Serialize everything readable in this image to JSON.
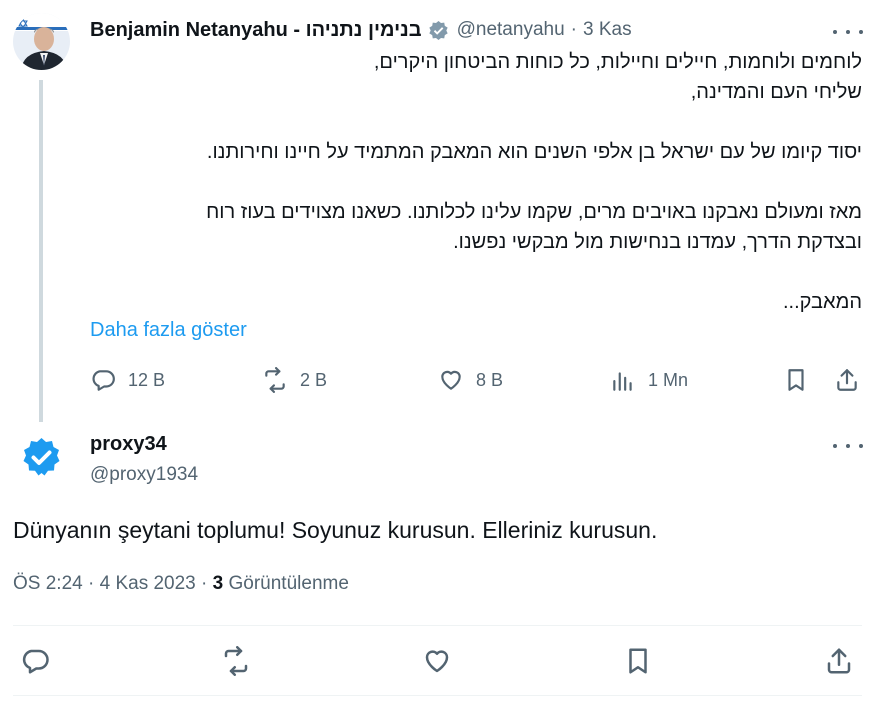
{
  "original": {
    "author_name": "Benjamin Netanyahu - בנימין נתניהו",
    "handle": "@netanyahu",
    "separator": "·",
    "time": "3 Kas",
    "body_lines": [
      "לוחמים ולוחמות, חיילים וחיילות, כל כוחות הביטחון היקרים,",
      "שליחי העם והמדינה,",
      "",
      "יסוד קיומו של עם ישראל בן אלפי השנים הוא המאבק המתמיד על חיינו וחירותנו.",
      "",
      "מאז ומעולם נאבקנו באויבים מרים, שקמו עלינו לכלותנו. כשאנו מצוידים בעוז רוח",
      "ובצדקת הדרך, עמדנו בנחישות מול מבקשי נפשנו.",
      "",
      "המאבק..."
    ],
    "show_more": "Daha fazla göster",
    "actions": {
      "replies": "12 B",
      "reposts": "2 B",
      "likes": "8 B",
      "views": "1 Mn"
    }
  },
  "reply": {
    "author_name": "proxy34",
    "handle": "@proxy1934",
    "text": "Dünyanın şeytani toplumu! Soyunuz kurusun. Elleriniz kurusun.",
    "time": "ÖS 2:24",
    "separator": "·",
    "date": "4 Kas 2023",
    "views_count": "3",
    "views_label": "Görüntülenme"
  },
  "colors": {
    "accent": "#1d9bf0",
    "text": "#0f1419",
    "muted": "#536471",
    "thread_line": "#cfd9de"
  },
  "icons": [
    "verified-badge-icon",
    "reply-icon",
    "repost-icon",
    "like-icon",
    "views-icon",
    "bookmark-icon",
    "share-icon",
    "more-icon"
  ]
}
